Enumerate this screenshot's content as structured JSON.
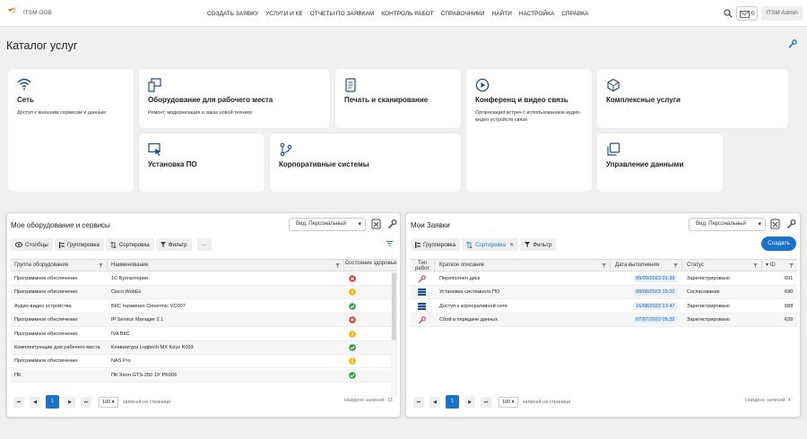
{
  "app": {
    "brand": "ITSM OOB",
    "user": "ITSM Admin",
    "messages": "0"
  },
  "nav": [
    "СОЗДАТЬ ЗАЯВКУ",
    "УСЛУГИ И КЕ",
    "ОТЧЕТЫ ПО ЗАЯВКАМ",
    "КОНТРОЛЬ РАБОТ",
    "СПРАВОЧНИКИ",
    "НАЙТИ",
    "НАСТРОЙКА",
    "СПРАВКА"
  ],
  "page": {
    "title": "Каталог услуг"
  },
  "catalog": [
    {
      "title": "Сеть",
      "desc": "Доступ к внешним сервисам и данным",
      "icon": "wifi-icon"
    },
    {
      "title": "Оборудование для рабочего места",
      "desc": "Ремонт, модернизация и заказ новой техники",
      "icon": "workplace-icon"
    },
    {
      "title": "Печать и сканирование",
      "desc": "",
      "icon": "document-icon"
    },
    {
      "title": "Конференц и видео связь",
      "desc": "Организация встреч с использованием аудио-видео устройств связи",
      "icon": "play-icon"
    },
    {
      "title": "Комплексные услуги",
      "desc": "",
      "icon": "cube-icon"
    },
    {
      "title": "Установка ПО",
      "desc": "",
      "icon": "monitor-cursor-icon"
    },
    {
      "title": "Корпоративные системы",
      "desc": "",
      "icon": "git-branch-icon"
    },
    {
      "title": "Управление данными",
      "desc": "",
      "icon": "copy-icon"
    }
  ],
  "equipment": {
    "title": "Мое оборудование и сервисы",
    "view": "Вид: Персональный",
    "toolbar": {
      "columns": "Столбцы",
      "group": "Группировка",
      "sort": "Сортировка",
      "filter": "Фильтр",
      "more": "···"
    },
    "columns": {
      "group": "Группа оборудования",
      "name": "Наименование",
      "health": "Состояние здоровья"
    },
    "rows": [
      {
        "group": "Программное обеспечение",
        "name": "1С Бухгалтерия",
        "health": "error"
      },
      {
        "group": "Программное обеспечение",
        "name": "Cisco WebEx",
        "health": "warning"
      },
      {
        "group": "Аудио-видео устройства",
        "name": "ВКС терминал Clevermic VC007",
        "health": "ok"
      },
      {
        "group": "Программное обеспечение",
        "name": "IP Service Manager 2.1",
        "health": "error"
      },
      {
        "group": "Программное обеспечение",
        "name": "IVA ВКС",
        "health": "warning"
      },
      {
        "group": "Комплектующие для рабочего места",
        "name": "Клавиатура Logitech MX Keys K003",
        "health": "ok"
      },
      {
        "group": "Программное обеспечение",
        "name": "NAS Pro",
        "health": "warning"
      },
      {
        "group": "ПК",
        "name": "ПК Xeon GTS-250 19' PK006",
        "health": "ok"
      }
    ],
    "pager": {
      "pages": [
        "⏮",
        "◀",
        "1",
        "▶",
        "⏭"
      ],
      "size": "100 ▾",
      "size_label": "записей на странице",
      "found": "Найдено записей: 13"
    }
  },
  "requests": {
    "title": "Мои Заявки",
    "view": "Вид: Персональный",
    "toolbar": {
      "group": "Группировка",
      "sort": "Сортировка",
      "filter": "Фильтр",
      "create": "Создать",
      "sort_close": "✕"
    },
    "columns": {
      "type": "Тип работ",
      "desc": "Краткое описание",
      "date": "Дата выполнения",
      "status": "Статус",
      "id": "▾ ID"
    },
    "rows": [
      {
        "type": "incident",
        "desc": "Переполнен диск",
        "date": "09/09/2023 01:39",
        "status": "Зарегистрировано",
        "id": "691"
      },
      {
        "type": "request",
        "desc": "Установка системного ПО",
        "date": "08/09/2023 15:22",
        "status": "Согласование",
        "id": "690"
      },
      {
        "type": "request",
        "desc": "Доступ к корпоративной сети",
        "date": "16/08/2023 13:47",
        "status": "Зарегистрировано",
        "id": "688"
      },
      {
        "type": "incident",
        "desc": "Сбой в передаче данных",
        "date": "07/07/2023 05:32",
        "status": "Зарегистрировано",
        "id": "639"
      }
    ],
    "pager": {
      "pages": [
        "⏮",
        "◀",
        "1",
        "▶",
        "⏭"
      ],
      "size": "100 ▾",
      "size_label": "записей на странице",
      "found": "Найдено записей: 4"
    }
  },
  "colors": {
    "accent": "#1a73c8",
    "ok": "#2ea043",
    "warning": "#f0b400",
    "error": "#d73a3a",
    "incident": "#d9534f"
  }
}
